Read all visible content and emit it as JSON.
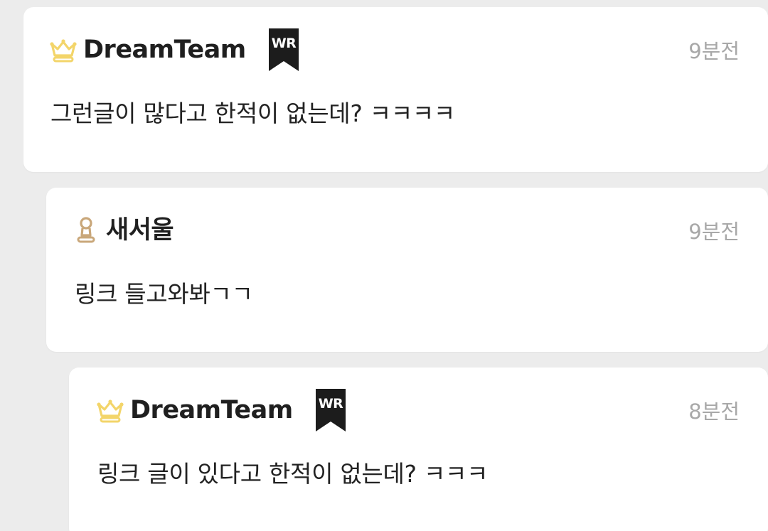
{
  "colors": {
    "page_background": "#ececec",
    "card_background": "#ffffff",
    "nickname": "#1f1f1f",
    "timestamp": "#a8a8a8",
    "crown_gold": "#f3d56a",
    "pawn_bronze": "#c9a77a",
    "wr_badge": "#1c1c1c"
  },
  "comments": [
    {
      "rank_icon": "crown-icon",
      "nickname": "DreamTeam",
      "badge": "WR",
      "time": "9분전",
      "text": "그런글이 많다고 한적이 없는데? ㅋㅋㅋㅋ"
    },
    {
      "rank_icon": "pawn-icon",
      "nickname": "새서울",
      "badge": "",
      "time": "9분전",
      "text": "링크 들고와봐ㄱㄱ"
    },
    {
      "rank_icon": "crown-icon",
      "nickname": "DreamTeam",
      "badge": "WR",
      "time": "8분전",
      "text": "링크 글이 있다고 한적이 없는데? ㅋㅋㅋ"
    }
  ]
}
